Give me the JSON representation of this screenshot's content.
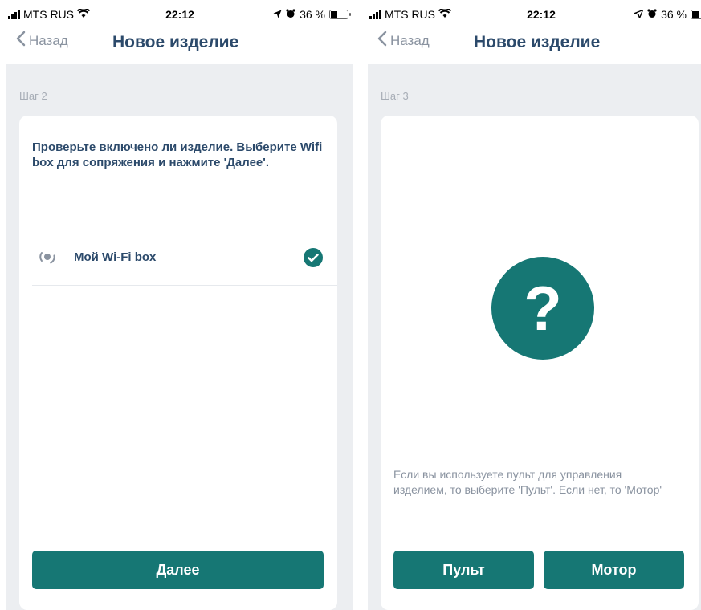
{
  "status": {
    "carrier": "MTS RUS",
    "time": "22:12",
    "battery_text": "36 %",
    "battery_level": 0.36
  },
  "nav": {
    "back_label": "Назад",
    "title": "Новое изделие"
  },
  "left_screen": {
    "step": "Шаг 2",
    "instruction": "Проверьте включено ли изделие. Выберите Wifi box для сопряжения и нажмите 'Далее'.",
    "device_name": "Мой Wi-Fi box",
    "device_selected": true,
    "next_button": "Далее"
  },
  "right_screen": {
    "step": "Шаг 3",
    "question_mark": "?",
    "hint": "Если вы используете пульт для управления изделием, то выберите 'Пульт'. Если нет, то 'Мотор'",
    "remote_button": "Пульт",
    "motor_button": "Мотор"
  },
  "colors": {
    "accent": "#167774",
    "title": "#2c4a6b",
    "muted": "#8a93a0",
    "background": "#eceef1"
  }
}
